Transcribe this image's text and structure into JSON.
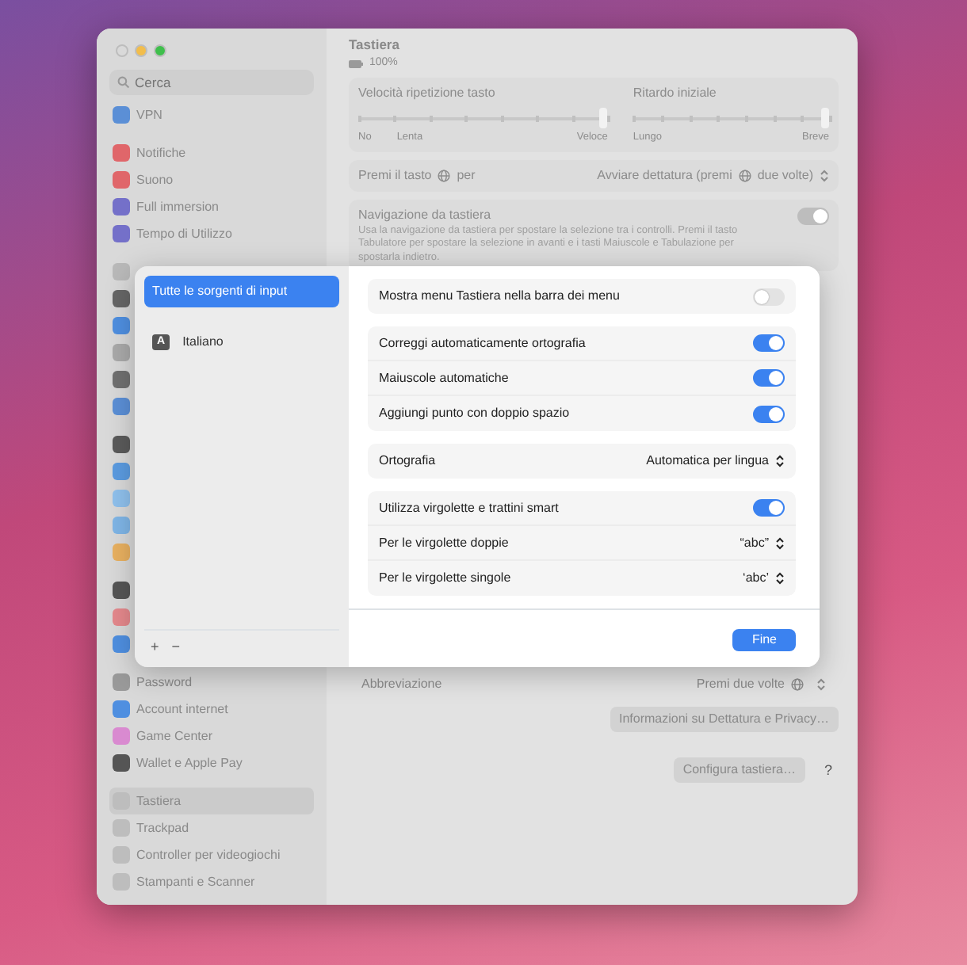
{
  "window": {
    "buttons": [
      {
        "color": "#d9d9d9"
      },
      {
        "color": "#f2bd4b"
      },
      {
        "color": "#3fbf4c"
      }
    ]
  },
  "sidebar": {
    "search": {
      "placeholder": "Cerca"
    },
    "groups": [
      [
        {
          "label": "VPN",
          "color": "#5b8fd6",
          "selected": false
        }
      ],
      [
        {
          "label": "Notifiche",
          "color": "#e0666a",
          "selected": false
        },
        {
          "label": "Suono",
          "color": "#e0666a",
          "selected": false
        },
        {
          "label": "Full immersion",
          "color": "#7470c9",
          "selected": false
        },
        {
          "label": "Tempo di Utilizzo",
          "color": "#7470c9",
          "selected": false
        }
      ],
      [
        {
          "color": "#b9b9b9",
          "selected": false
        },
        {
          "color": "#666666",
          "selected": false
        },
        {
          "color": "#4f8fe0",
          "selected": false
        },
        {
          "color": "#a9a9a9",
          "selected": false
        },
        {
          "color": "#707070",
          "selected": false
        },
        {
          "color": "#5b8fd6",
          "selected": false
        }
      ],
      [
        {
          "color": "#5a5a5a",
          "selected": false
        },
        {
          "color": "#5b9be0",
          "selected": false
        },
        {
          "color": "#8fc0ec",
          "selected": false
        },
        {
          "color": "#7fb5e6",
          "selected": false
        },
        {
          "color": "#e8b060",
          "selected": false
        }
      ],
      [
        {
          "color": "#555555",
          "selected": false
        },
        {
          "color": "#e4888c",
          "selected": false
        },
        {
          "color": "#4f8fe0",
          "selected": false
        }
      ],
      [
        {
          "label": "Password",
          "color": "#9a9a9a",
          "selected": false
        },
        {
          "label": "Account internet",
          "color": "#4f8fe0",
          "selected": false
        },
        {
          "label": "Game Center",
          "color": "#d98ad0",
          "selected": false
        },
        {
          "label": "Wallet e Apple Pay",
          "color": "#555555",
          "selected": false
        }
      ],
      [
        {
          "label": "Tastiera",
          "color": "#bdbdbd",
          "selected": true
        },
        {
          "label": "Trackpad",
          "color": "#bdbdbd",
          "selected": false
        },
        {
          "label": "Controller per videogiochi",
          "color": "#bdbdbd",
          "selected": false
        },
        {
          "label": "Stampanti e Scanner",
          "color": "#bdbdbd",
          "selected": false
        }
      ]
    ]
  },
  "main": {
    "title": "Tastiera",
    "battery": "100%",
    "sliders": [
      {
        "label": "Velocità ripetizione tasto",
        "level": 1,
        "scale_labels": [
          "No",
          "Lenta",
          "Veloce"
        ]
      },
      {
        "label": "Ritardo iniziale",
        "level": 1,
        "scale_labels": [
          "Lungo",
          "Breve"
        ]
      }
    ],
    "globe_row": {
      "label_before": "Premi il tasto",
      "label_after": "per",
      "value_before": "Avviare dettatura (premi",
      "value_after": "due volte)"
    },
    "keyboard_navigation": {
      "label": "Navigazione da tastiera",
      "on": true,
      "description": "Usa la navigazione da tastiera per spostare la selezione tra i controlli. Premi il tasto Tabulatore per spostare la selezione in avanti e i tasti Maiuscole e Tabulazione per spostarla indietro."
    },
    "shortcut_row": {
      "label": "Abbreviazione",
      "value": "Premi due volte"
    },
    "privacy_button": "Informazioni su Dettatura e Privacy…",
    "configure_button": "Configura tastiera…",
    "help_button": "?"
  },
  "sheet": {
    "sources": [
      {
        "label": "Tutte le sorgenti di input",
        "selected": true
      },
      {
        "badge": "A",
        "label": "Italiano",
        "selected": false
      }
    ],
    "add_button": "+",
    "remove_button": "−",
    "groups": [
      [
        {
          "kind": "toggle",
          "label": "Mostra menu Tastiera nella barra dei menu",
          "on": false
        }
      ],
      [
        {
          "kind": "toggle",
          "label": "Correggi automaticamente ortografia",
          "on": true
        },
        {
          "kind": "toggle",
          "label": "Maiuscole automatiche",
          "on": true
        },
        {
          "kind": "toggle",
          "label": "Aggiungi punto con doppio spazio",
          "on": true
        }
      ],
      [
        {
          "kind": "select",
          "label": "Ortografia",
          "value": "Automatica per lingua"
        }
      ],
      [
        {
          "kind": "toggle",
          "label": "Utilizza virgolette e trattini smart",
          "on": true
        },
        {
          "kind": "select",
          "label": "Per le virgolette doppie",
          "value": "“abc”"
        },
        {
          "kind": "select",
          "label": "Per le virgolette singole",
          "value": "‘abc’"
        }
      ]
    ],
    "done_button": "Fine"
  }
}
